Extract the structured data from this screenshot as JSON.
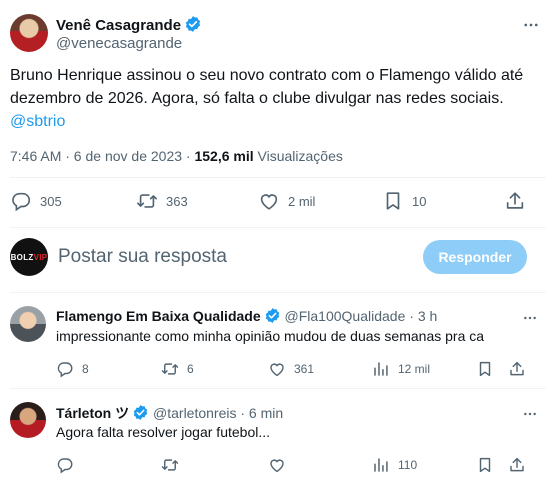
{
  "main_tweet": {
    "author_name": "Venê Casagrande",
    "author_handle": "@venecasagrande",
    "text": "Bruno Henrique assinou o seu novo contrato com o Flamengo válido até dezembro de 2026. Agora, só falta o clube divulgar nas redes sociais.",
    "mention": "@sbtrio",
    "time": "7:46 AM · 6 de nov de 2023 · ",
    "views_count": "152,6 mil",
    "views_label": " Visualizações",
    "replies": "305",
    "retweets": "363",
    "likes": "2 mil",
    "bookmarks": "10"
  },
  "reply_box": {
    "avatar_text_a": "BOLZ",
    "avatar_text_b": "VIP",
    "placeholder": "Postar sua resposta",
    "button": "Responder"
  },
  "replies": [
    {
      "name": "Flamengo Em Baixa Qualidade",
      "handle": "@Fla100Qualidade",
      "time": " · 3 h",
      "text": "impressionante como minha opinião mudou de duas semanas pra ca",
      "replies": "8",
      "retweets": "6",
      "likes": "361",
      "views": "12 mil"
    },
    {
      "name": "Tárleton ツ",
      "handle": "@tarletonreis",
      "time": " · 6 min",
      "text": "Agora falta resolver jogar futebol...",
      "replies": "",
      "retweets": "",
      "likes": "",
      "views": "110"
    }
  ],
  "colors": {
    "accent": "#1d9bf0",
    "text": "#0f1419",
    "secondary": "#536471",
    "reply_button": "#8ecdf8"
  },
  "icons": [
    "verified-badge-icon",
    "more-icon",
    "reply-icon",
    "retweet-icon",
    "like-icon",
    "bookmark-icon",
    "share-icon",
    "views-icon"
  ]
}
